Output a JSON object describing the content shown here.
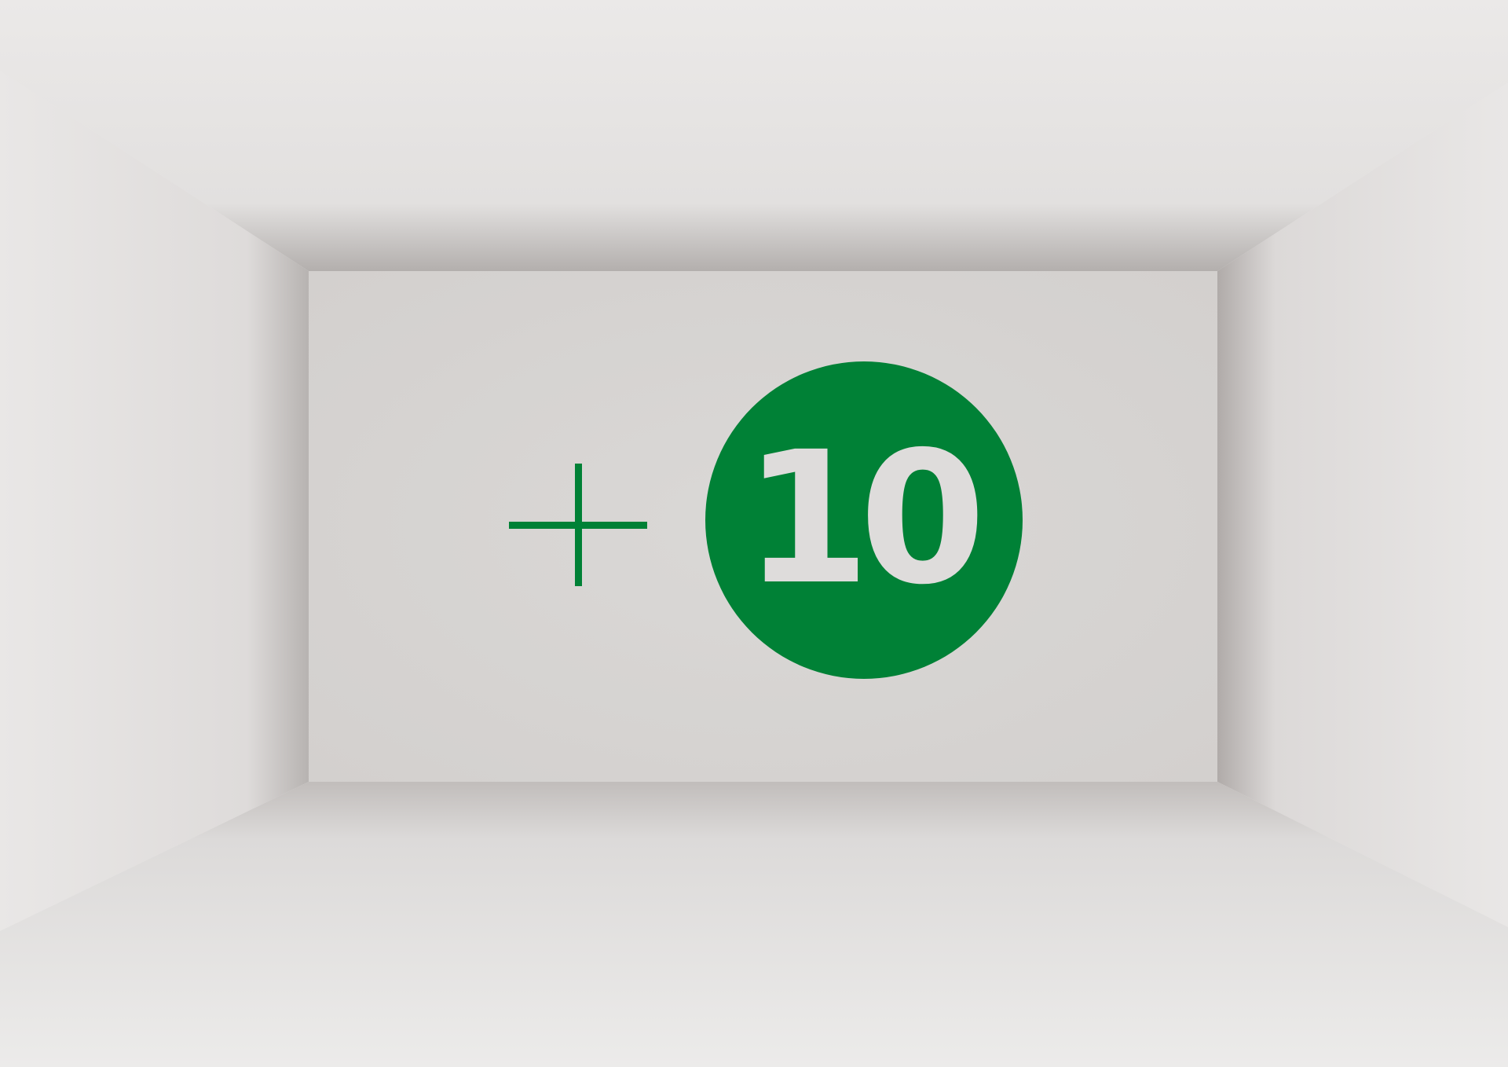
{
  "badge": {
    "number": "10",
    "color": "#008136"
  },
  "plus_symbol": {
    "glyph": "+",
    "color": "#008136"
  },
  "room": {
    "back_wall_color": "#d7d5d3",
    "ceiling_color": "#e6e4e3",
    "floor_color": "#e4e2e1",
    "side_wall_color": "#e2e0df"
  }
}
